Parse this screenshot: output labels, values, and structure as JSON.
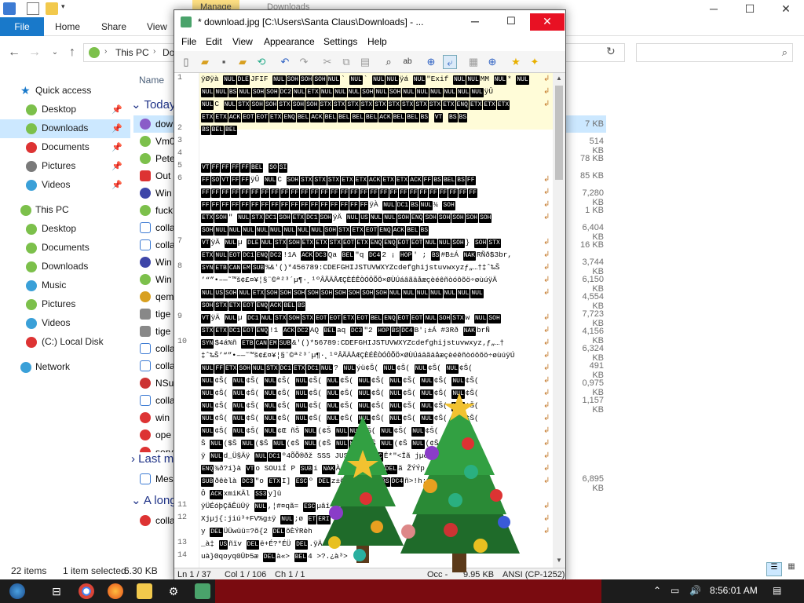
{
  "explorer": {
    "ribbon_context": "Manage",
    "ribbon_context2": "Downloads",
    "tabs": [
      "File",
      "Home",
      "Share",
      "View"
    ],
    "address": {
      "pc": "This PC",
      "folder": "Do"
    },
    "column_name": "Name",
    "nav": {
      "quick_access": "Quick access",
      "qa_items": [
        "Desktop",
        "Downloads",
        "Documents",
        "Pictures",
        "Videos"
      ],
      "this_pc": "This PC",
      "pc_items": [
        "Desktop",
        "Documents",
        "Downloads",
        "Music",
        "Pictures",
        "Videos",
        "(C:) Local Disk"
      ],
      "network": "Network"
    },
    "groups": {
      "today": "Today",
      "last": "Last m",
      "along": "A long"
    },
    "files": [
      "dow",
      "Vm0",
      "Pete",
      "Out",
      "Win",
      "fuck",
      "colla",
      "colla",
      "Win",
      "Win",
      "qem",
      "tige",
      "tige",
      "colla",
      "colla",
      "NSu",
      "colla",
      "win",
      "ope",
      "serv",
      "Mes",
      "colla"
    ],
    "sizes": [
      "7 KB",
      "514 KB",
      "78 KB",
      "85 KB",
      "7,280 KB",
      "1 KB",
      "6,404 KB",
      "16 KB",
      "3,744 KB",
      "6,150 KB",
      "4,554 KB",
      "7,723 KB",
      "4,156 KB",
      "6,324 KB",
      "491 KB",
      "0,975 KB",
      "1,157 KB",
      "6,895 KB"
    ],
    "status": {
      "items": "22 items",
      "selected": "1 item selected",
      "size": "6.30 KB"
    }
  },
  "notepad": {
    "title": "* download.jpg [C:\\Users\\Santa Claus\\Downloads] - ...",
    "menu": [
      "File",
      "Edit",
      "View",
      "Appearance",
      "Settings",
      "Help"
    ],
    "line_numbers": [
      "1",
      "2",
      "3",
      "4",
      "5",
      "6",
      "7",
      "8",
      "9",
      "10",
      "11",
      "12",
      "13",
      "14"
    ],
    "text_lines": [
      "ÿØÿà NUL DLE JFIF NUL SOH SOH SOH NUL ` NUL ` NUL NUL ÿá NUL \"Exif NUL NUL MM NUL * NUL",
      "NUL NUL BS NUL SOH SOH DC2 NUL ETX NUL NUL NUL SOH NUL SOH NUL NUL NUL NUL NUL NUL ÿÛ",
      "NUL C NUL STX SOH SOH STX SOH SOH STX STX STX STX STX STX STX STX STX ETX ENQ ETX ETX ETX",
      "ETX ETX ACK EOT EOT ETX ENQ BEL ACK BEL BEL BEL BEL ACK BEL BEL BS  VT  BS BS",
      "BS BEL BEL",
      "",
      "",
      "VT FF FF FF FF BEL  SO SI",
      "FF SO VT FF FF ÿÛ NUL C SOH STX STX STX ETX ETX ACK ETX ETX ACK FF BS BEL BS FF",
      "FF FF FF FF FF FF FF FF FF FF FF FF FF FF FF FF FF FF FF FF FF FF FF FF FF FF FF FF",
      "FF FF FF FF FF FF FF FF FF FF FF FF FF FF FF FF FF ÿÀ NUL DC1 BS NUL ¼ SOH",
      "ETX SOH \" NUL STX DC1 SOH ETX DC1 SOH ÿÄ NUL US NUL NUL SOH ENQ SOH SOH SOH SOH SOH",
      "SOH NUL NUL NUL NUL NUL NUL NUL NUL SOH STX ETX EOT ENQ ACK BEL BS",
      "VT ÿÄ NUL µ DLE NUL STX SOH ETX ETX STX EOT ETX ENQ ENQ EOT EOT NUL NUL SOH } SOH STX",
      "ETX NUL EOT DC1 ENQ DC2 !1A ACK DC3 Qa BEL \"q DC4 2 ¡ HOP ' ; BS #B±Á NAK RÑð$3br,",
      "SYN ETB CAN EM SUB %&'()*456789:CDEFGHIJSTUVWXYZcdefghijstuvwxyzƒ„…†‡ˆ‰Š",
      "’“”•–—˜™š¢£¤¥¦§¨©ª²³´µ¶·¸¹ºÂÃÄÅÆÇÈÉÊÒÓÔÕÖ×ØÙÚáâãäåæçèéêñòóôõö÷øùúÿÄ",
      "NUL US SOH NUL ETX SOH SOH SOH SOH SOH SOH SOH SOH SOH NUL NUL NUL NUL NUL NUL NUL",
      "SOH STX ETX EOT ENQ ACK BEL BS",
      "VT ÿÄ NUL µ DC1 NUL STX SOH STX EOT EOT ETX EOT BEL ENQ EOT EOT NUL SOH STX w NUL SOH",
      "STX ETX DC1 EOT ENQ !1 ACK DC2 AQ BEL aq DC3 \"2 HOP BS DC4 B'¡±Á  #3Rð NAK brÑ",
      "SYN $4á%ñ ETB CAN EM SUB &'()*56789:CDEFGHIJSTUVWXYZcdefghijstuvwxyz‚ƒ„…†",
      "‡ˆ‰Š’“”•–—˜™š¢£¤¥¦§¨©ª²³´µ¶·¸¹ºÂÃÄÅÆÇÈÉÊÒÓÔÕÖ×ØÙÚáâãäåæçèéêñòóôõö÷øùúÿÚ",
      "NUL FF ETX SOH NUL STX DC1 ETX DC1 NUL ? NUL ýü¢Š( NUL ¢Š( NUL ¢Š( NUL ¢Š(",
      "NUL ¢Š( NUL ¢Š( NUL ¢Š( NUL ¢Š( NUL ¢Š( NUL ¢Š( NUL ¢Š( NUL ¢Š( NUL ¢Š(",
      "NUL ¢Š( NUL ¢Š( NUL ¢Š( NUL ¢Š( NUL ¢Š( NUL ¢Š( NUL ¢Š( NUL ¢Š( NUL ¢Š(",
      "NUL ¢Š( NUL ¢Š( NUL ¢Š( NUL ¢Š( NUL ¢Š( NUL ¢Š( NUL ¢Š( NUL ¢Š( NUL ¢Š(",
      "NUL ¢Š( NUL ¢Š( NUL ¢Š( NUL ¢Š( NUL ¢Š( NUL ¢Š( NUL ¢Š( NUL ¢Š( NUL ¢Š(",
      "NUL ¢Š( NUL ¢Š( NUL ¢Œ ñŠ NUL (¢Š NUL NUL ¢Š( NUL ¢Š( NUL ¢Š(",
      "Š NUL ($Š NUL ($Š NUL (¢Š NUL (¢Š NUL NUL (¢Š NUL (¢Š NUL (¢Š NUL (¢",
      "ÿ NUL d_Ü§Äÿ NUL DC1 º4ÕÕ®ðž SSS JUSUB O OSC Ë*\"<Ïã jµðÇìEÿ NUL",
      "ENQ ¾ð?í}à VT o SOUìÍ P SUB í NAK À¿Ž-1·¿ŽZ9 DEL ã ŽÝÝp ÿ,..",
      "SUB ðêèlà DC3 \"o ETX I] ESC º DEL z±õ\"¹ RS †! BS DC4 ñ>!h:mÕ",
      "Ô ACK xmiKÄl SS3 y]û",
      "ÿÜÉóþÇåÊüÜÿ NUL ,¦#¤qã= ESC µâî M:tý¬¶",
      "Xjµj{:jiú³+FV%g±ÿ NUL ;ø ET ERI",
      "y DEL ÜÜwüü=?õ{2 DEL õÈÝRèh",
      "_à‡ US ñïv DEL ë+É?*ÉÜ DEL .ÿÄ",
      "uà}Θqoyq0ÜÞ5æ DEL à«> BEL 4 >?.¿à³>"
    ],
    "status": {
      "ln": "Ln  1 / 37",
      "col": "Col  1 / 106",
      "ch": "Ch  1 / 1",
      "occ": "Occ  -",
      "size": "9.95 KB",
      "enc": "ANSI (CP-1252)"
    }
  },
  "taskbar": {
    "time": "8:56:01 AM"
  }
}
